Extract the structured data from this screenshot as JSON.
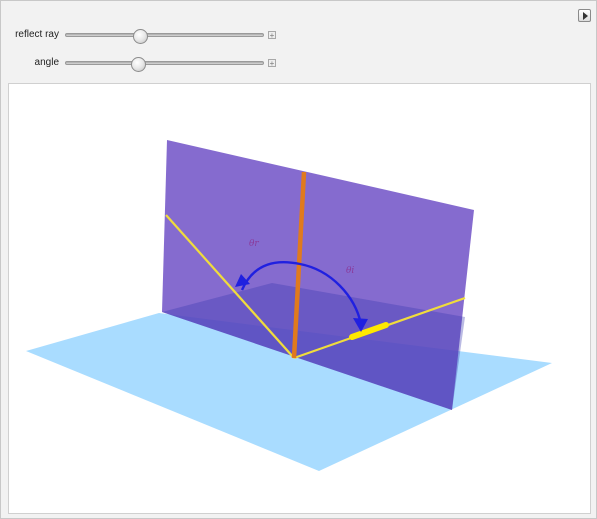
{
  "controls": {
    "reflect_ray": {
      "label": "reflect ray",
      "value": 0.37
    },
    "angle": {
      "label": "angle",
      "value": 0.36
    }
  },
  "scene": {
    "theta_r": "θr",
    "theta_i": "θi",
    "colors": {
      "ground_plane": "#a9dcff",
      "vertical_plane": "#6a4bc4",
      "normal_line": "#e07a1e",
      "rays": "#f0dc3c",
      "angle_arc": "#2020e0",
      "arrow_highlight": "#ffe800",
      "angle_text": "#8a3a9a"
    }
  }
}
